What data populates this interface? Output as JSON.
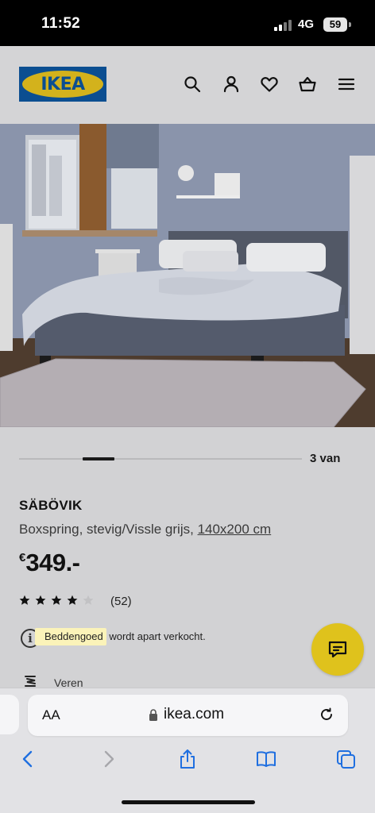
{
  "status_bar": {
    "time": "11:52",
    "network": "4G",
    "battery": "59"
  },
  "header": {
    "logo_text": "IKEA",
    "icons": [
      "search-icon",
      "user-icon",
      "heart-icon",
      "basket-icon",
      "menu-icon"
    ]
  },
  "gallery": {
    "page_count": "3 van",
    "progress": 0.333
  },
  "product": {
    "name": "SÄBÖVIK",
    "description": "Boxspring, stevig/Vissle grijs, ",
    "size": "140x200 cm",
    "price_currency": "€",
    "price": "349.-",
    "rating": 4,
    "rating_max": 5,
    "review_count": "(52)",
    "info_highlight": "Beddengoed",
    "info_rest": " wordt apart verkocht.",
    "feature_label": "Veren"
  },
  "browser": {
    "aa_label": "AA",
    "url": "ikea.com",
    "toolbar": [
      "back-icon",
      "forward-icon",
      "share-icon",
      "bookmarks-icon",
      "tabs-icon"
    ]
  },
  "colors": {
    "ikea_blue": "#0b4e91",
    "ikea_yellow": "#d3b21c",
    "chat_yellow": "#dfc21c",
    "highlight": "#fbf3b9"
  }
}
